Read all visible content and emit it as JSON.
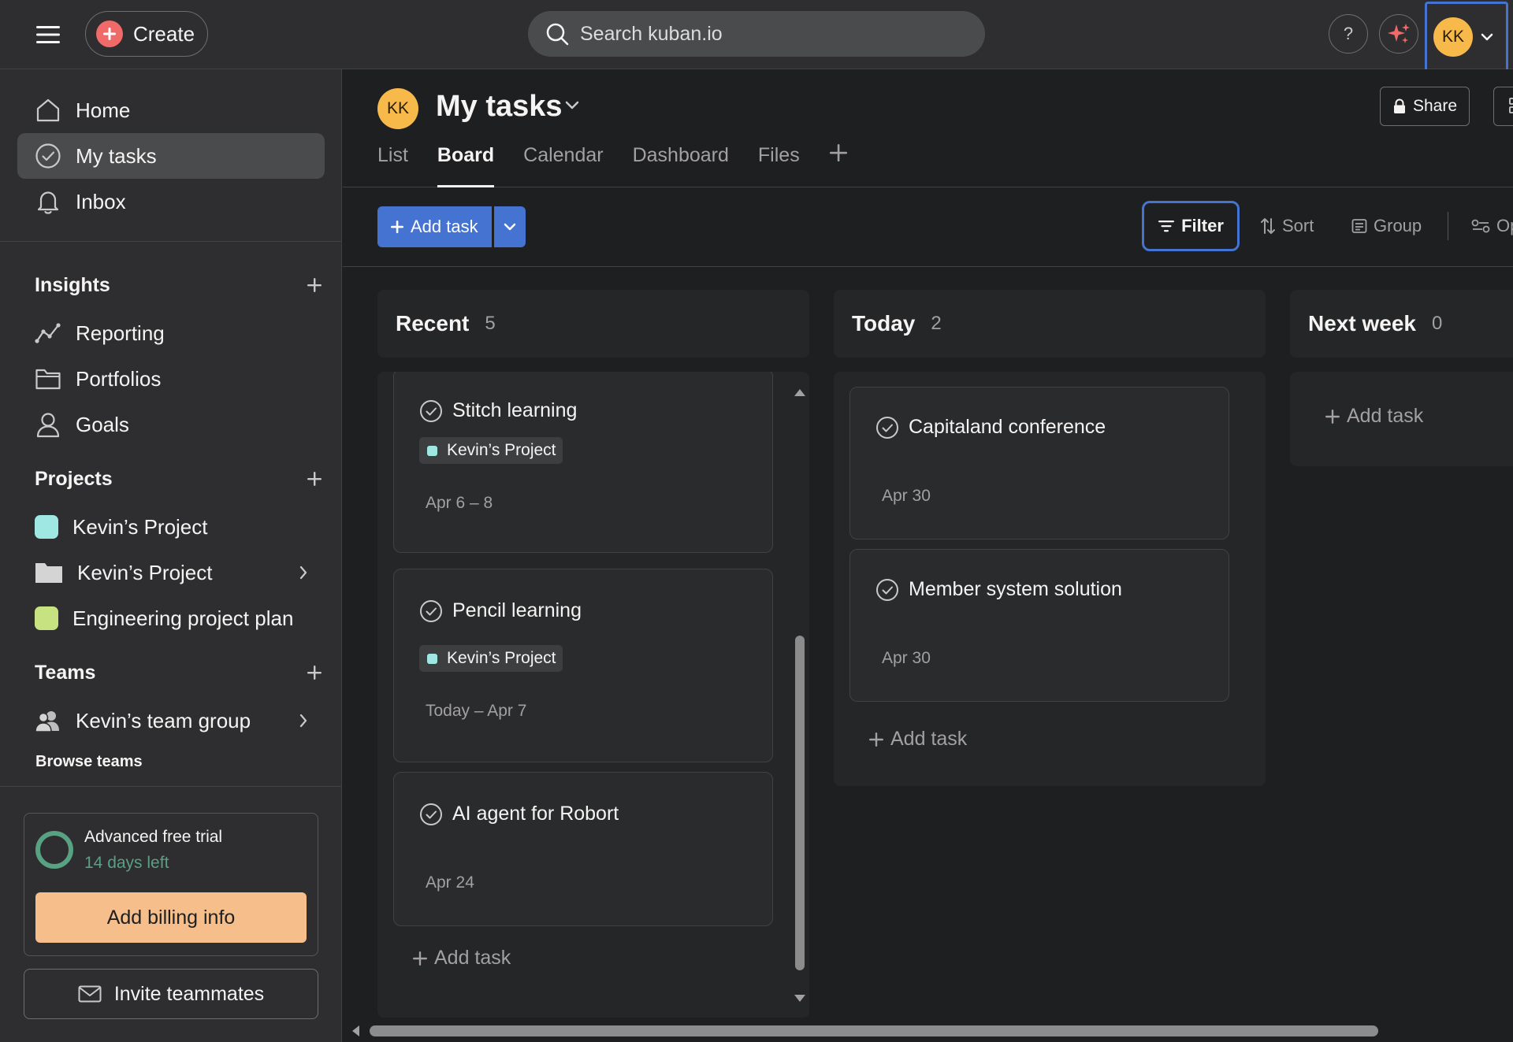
{
  "topbar": {
    "create_label": "Create",
    "search_placeholder": "Search kuban.io",
    "help_label": "?",
    "avatar_initials": "KK"
  },
  "sidebar": {
    "nav": [
      {
        "label": "Home",
        "icon": "home-icon"
      },
      {
        "label": "My tasks",
        "icon": "check-circle-icon",
        "active": true
      },
      {
        "label": "Inbox",
        "icon": "bell-icon"
      }
    ],
    "insights": {
      "title": "Insights",
      "items": [
        {
          "label": "Reporting",
          "icon": "chart-line-icon"
        },
        {
          "label": "Portfolios",
          "icon": "folder-icon"
        },
        {
          "label": "Goals",
          "icon": "person-goal-icon"
        }
      ]
    },
    "projects": {
      "title": "Projects",
      "items": [
        {
          "label": "Kevin’s Project",
          "color": "#9ee7e3"
        },
        {
          "label": "Kevin’s Project",
          "icon": "folder-filled-icon"
        },
        {
          "label": "Engineering project plan",
          "color": "#c7e381"
        }
      ]
    },
    "teams": {
      "title": "Teams",
      "items": [
        {
          "label": "Kevin’s team group",
          "icon": "team-icon"
        }
      ],
      "browse_label": "Browse teams"
    },
    "trial": {
      "title": "Advanced free trial",
      "days_left": "14 days left",
      "billing_label": "Add billing info"
    },
    "invite_label": "Invite teammates"
  },
  "main": {
    "avatar_initials": "KK",
    "title": "My tasks",
    "share_label": "Share",
    "tabs": [
      {
        "label": "List"
      },
      {
        "label": "Board",
        "active": true
      },
      {
        "label": "Calendar"
      },
      {
        "label": "Dashboard"
      },
      {
        "label": "Files"
      }
    ],
    "toolbar": {
      "add_task_label": "Add task",
      "filter_label": "Filter",
      "sort_label": "Sort",
      "group_label": "Group",
      "options_label": "Options"
    }
  },
  "board": {
    "columns": [
      {
        "title": "Recent",
        "count": "5",
        "cards": [
          {
            "title": "Stitch learning",
            "tag": "Kevin’s Project",
            "date": "Apr 6 – 8"
          },
          {
            "title": "Pencil learning",
            "tag": "Kevin’s Project",
            "date": "Today – Apr 7"
          },
          {
            "title": "AI agent for Robort",
            "date": "Apr 24"
          }
        ],
        "add_label": "Add task"
      },
      {
        "title": "Today",
        "count": "2",
        "cards": [
          {
            "title": "Capitaland conference",
            "date": "Apr 30"
          },
          {
            "title": "Member system solution",
            "date": "Apr 30"
          }
        ],
        "add_label": "Add task"
      },
      {
        "title": "Next week",
        "count": "0",
        "cards": [],
        "add_label": "Add task"
      }
    ]
  },
  "colors": {
    "accent": "#4573d2",
    "create": "#f06a6a",
    "avatar": "#f8b94b",
    "trial": "#58a182",
    "billing": "#f5be8a"
  }
}
